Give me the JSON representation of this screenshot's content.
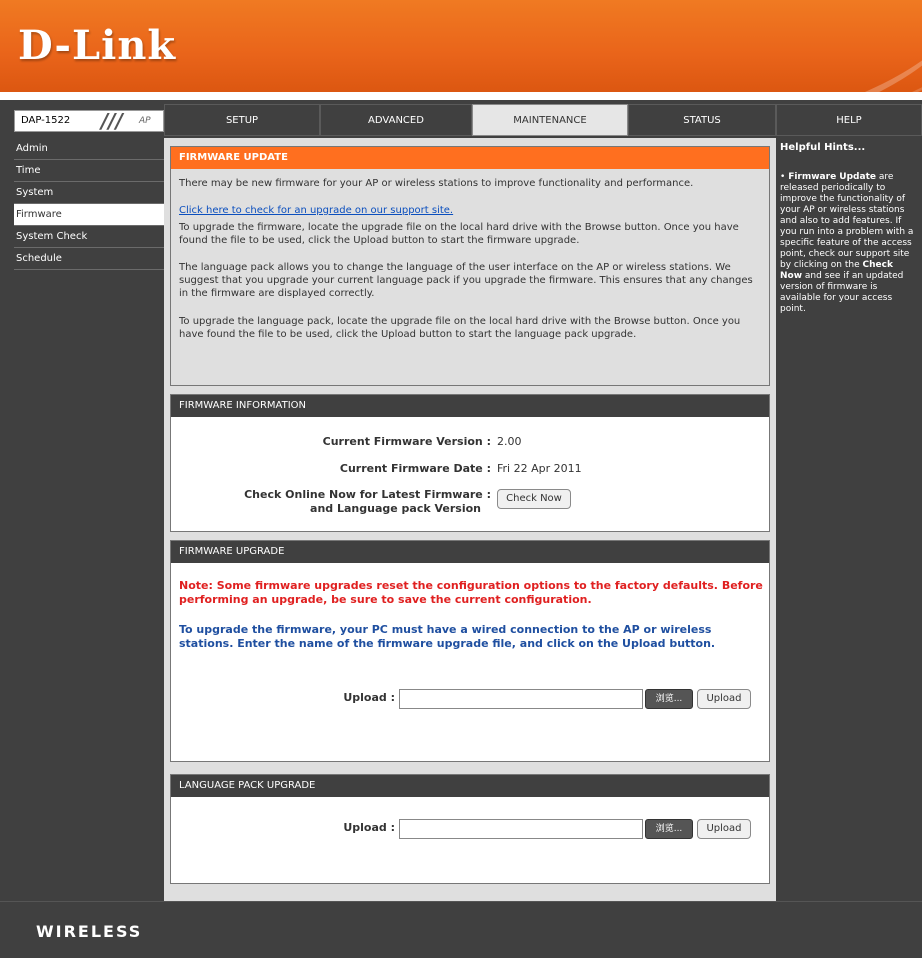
{
  "brand": {
    "logo": "D-Link"
  },
  "model": {
    "name": "DAP-1522",
    "slash": "///",
    "ap": "AP"
  },
  "tabs": [
    {
      "label": "SETUP"
    },
    {
      "label": "ADVANCED"
    },
    {
      "label": "MAINTENANCE"
    },
    {
      "label": "STATUS"
    },
    {
      "label": "HELP"
    }
  ],
  "active_tab": "MAINTENANCE",
  "sidebar": {
    "items": [
      {
        "label": "Admin"
      },
      {
        "label": "Time"
      },
      {
        "label": "System"
      },
      {
        "label": "Firmware"
      },
      {
        "label": "System Check"
      },
      {
        "label": "Schedule"
      }
    ],
    "active": "Firmware"
  },
  "firmware_update": {
    "title": "FIRMWARE UPDATE",
    "p1": "There may be new firmware for your AP or wireless stations to improve functionality and performance.",
    "link": "Click here to check for an upgrade on our support site.",
    "p2": "To upgrade the firmware, locate the upgrade file on the local hard drive with the Browse button. Once you have found the file to be used, click the Upload button to start the firmware upgrade.",
    "p3": "The language pack allows you to change the language of the user interface on the AP or wireless stations. We suggest that you upgrade your current language pack if you upgrade the firmware. This ensures that any changes in the firmware are displayed correctly.",
    "p4": "To upgrade the language pack, locate the upgrade file on the local hard drive with the Browse button. Once you have found the file to be used, click the Upload button to start the language pack upgrade."
  },
  "firmware_info": {
    "title": "FIRMWARE INFORMATION",
    "version_label": "Current Firmware Version :",
    "version_value": "2.00",
    "date_label": "Current Firmware Date :",
    "date_value": "Fri 22 Apr 2011",
    "check_label_1": "Check Online Now for Latest Firmware :",
    "check_label_2": "and Language pack Version",
    "check_button": "Check Now"
  },
  "firmware_upgrade": {
    "title": "FIRMWARE UPGRADE",
    "note": "Note: Some firmware upgrades reset the configuration options to the factory defaults. Before performing an upgrade, be sure to save the current configuration.",
    "instructions": "To upgrade the firmware, your PC must have a wired connection to the AP or wireless stations. Enter the name of the firmware upgrade file, and click on the Upload button.",
    "upload_label": "Upload :",
    "browse_label": "浏览...",
    "upload_button": "Upload"
  },
  "language_upgrade": {
    "title": "LANGUAGE PACK UPGRADE",
    "upload_label": "Upload :",
    "browse_label": "浏览...",
    "upload_button": "Upload"
  },
  "help": {
    "title": "Helpful Hints...",
    "bullet": "•",
    "heading": "Firmware Update",
    "text1": "are released periodically to improve the functionality of your AP or wireless stations and also to add features. If you run into a problem with a specific feature of the access point, check our support site by clicking on the",
    "bold2": "Check Now",
    "text2": "and see if an updated version of firmware is available for your access point."
  },
  "footer": {
    "text": "WIRELESS"
  },
  "colors": {
    "header_orange": "#e9641a",
    "dark_gray": "#404040",
    "section_orange": "#ff6f1f",
    "note_red": "#e02020",
    "note_blue": "#1f4fa0",
    "link_blue": "#0b4fbe"
  }
}
